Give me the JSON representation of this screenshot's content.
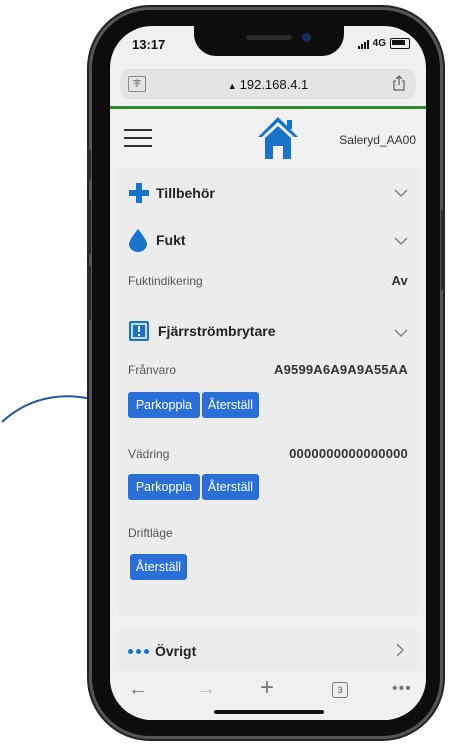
{
  "status": {
    "time": "13:17",
    "network": "4G"
  },
  "browser": {
    "url": "192.168.4.1",
    "tab_count": "3"
  },
  "header": {
    "device_name": "Saleryd_AA00"
  },
  "sections": {
    "accessories": {
      "title": "Tillbehör"
    },
    "humidity": {
      "title": "Fukt",
      "row_label": "Fuktindikering",
      "row_value": "Av"
    },
    "remote_switch": {
      "title": "Fjärrströmbrytare",
      "franvaro": {
        "label": "Frånvaro",
        "value": "A9599A6A9A9A55AA",
        "pair_label": "Parkoppla",
        "reset_label": "Återställ"
      },
      "vadring": {
        "label": "Vädring",
        "value": "0000000000000000",
        "pair_label": "Parkoppla",
        "reset_label": "Återställ"
      },
      "driftlage": {
        "label": "Driftläge",
        "reset_label": "Återställ"
      }
    },
    "other": {
      "title": "Övrigt"
    }
  },
  "colors": {
    "accent": "#2a6fd6",
    "icon_blue": "#1a73c9",
    "divider_green": "#2e8b2e"
  }
}
